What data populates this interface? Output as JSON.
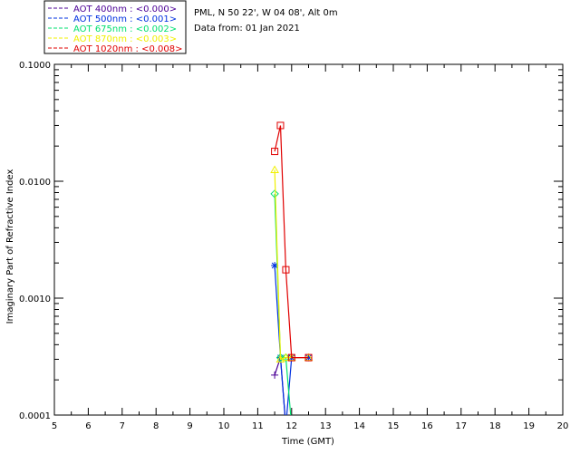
{
  "header": {
    "site": "PML, N 50 22', W 04 08', Alt 0m",
    "date": "Data from: 01 Jan 2021"
  },
  "chart_data": {
    "type": "line",
    "xlabel": "Time (GMT)",
    "ylabel": "Imaginary Part of Refractive Index",
    "xlim": [
      5,
      20
    ],
    "ylim": [
      0.0001,
      0.1
    ],
    "yscale": "log",
    "x_ticks": [
      "5",
      "6",
      "7",
      "8",
      "9",
      "10",
      "11",
      "12",
      "13",
      "14",
      "15",
      "16",
      "17",
      "18",
      "19",
      "20"
    ],
    "y_ticks": [
      "0.0001",
      "0.0010",
      "0.0100",
      "0.1000"
    ],
    "grid": false,
    "legend_position": "top-left, outside plot",
    "series": [
      {
        "name": "AOT  400nm : <0.000>",
        "color": "#4b0096",
        "marker": "plus",
        "points": [
          [
            11.5,
            0.00022
          ],
          [
            11.67,
            0.00031
          ],
          [
            11.83,
            8e-05
          ],
          [
            12.5,
            8e-05
          ]
        ]
      },
      {
        "name": "AOT  500nm : <0.001>",
        "color": "#0030e0",
        "marker": "asterisk",
        "points": [
          [
            11.5,
            0.0019
          ],
          [
            11.67,
            0.00031
          ],
          [
            11.83,
            8e-05
          ],
          [
            12.0,
            0.00031
          ],
          [
            12.5,
            0.00031
          ]
        ]
      },
      {
        "name": "AOT  675nm : <0.002>",
        "color": "#00e070",
        "marker": "diamond",
        "points": [
          [
            11.5,
            0.0078
          ],
          [
            11.67,
            0.00031
          ],
          [
            11.83,
            0.00031
          ],
          [
            12.0,
            8e-05
          ],
          [
            12.5,
            8e-05
          ]
        ]
      },
      {
        "name": "AOT  870nm : <0.003>",
        "color": "#f0f000",
        "marker": "triangle",
        "points": [
          [
            11.5,
            0.0125
          ],
          [
            11.67,
            0.0003
          ],
          [
            11.83,
            0.00031
          ],
          [
            12.0,
            0.00031
          ],
          [
            12.5,
            0.00031
          ]
        ]
      },
      {
        "name": "AOT 1020nm : <0.008>",
        "color": "#e00000",
        "marker": "square",
        "points": [
          [
            11.5,
            0.018
          ],
          [
            11.67,
            0.03
          ],
          [
            11.83,
            0.00175
          ],
          [
            12.0,
            0.00031
          ],
          [
            12.5,
            0.00031
          ]
        ]
      }
    ]
  }
}
